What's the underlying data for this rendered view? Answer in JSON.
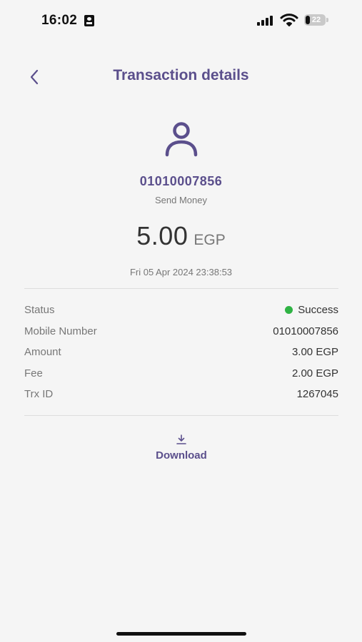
{
  "status_bar": {
    "time": "16:02",
    "battery_level": "22",
    "icons": [
      "id-card-icon",
      "cellular-signal-icon",
      "wifi-icon",
      "battery-icon"
    ]
  },
  "header": {
    "title": "Transaction details",
    "back_icon": "chevron-left-icon"
  },
  "transaction": {
    "avatar_icon": "user-icon",
    "counterparty": "01010007856",
    "type": "Send Money",
    "amount": "5.00",
    "currency": "EGP",
    "timestamp": "Fri 05 Apr 2024 23:38:53"
  },
  "details": [
    {
      "label": "Status",
      "value": "Success"
    },
    {
      "label": "Mobile Number",
      "value": "01010007856"
    },
    {
      "label": "Amount",
      "value": "3.00 EGP"
    },
    {
      "label": "Fee",
      "value": "2.00 EGP"
    },
    {
      "label": "Trx ID",
      "value": "1267045"
    }
  ],
  "download": {
    "label": "Download",
    "icon": "download-icon"
  },
  "colors": {
    "accent": "#5b4f8c",
    "success": "#2fb344",
    "background": "#f5f5f5"
  }
}
